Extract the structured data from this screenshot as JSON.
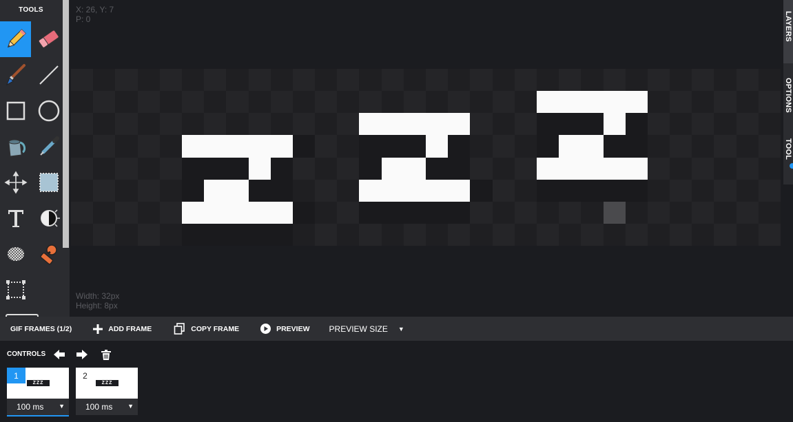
{
  "tools": {
    "title": "TOOLS",
    "items": [
      {
        "name": "pencil",
        "icon": "pencil-icon",
        "active": true
      },
      {
        "name": "eraser",
        "icon": "eraser-icon"
      },
      {
        "name": "brush",
        "icon": "brush-icon"
      },
      {
        "name": "line",
        "icon": "line-icon"
      },
      {
        "name": "rectangle",
        "icon": "rectangle-icon"
      },
      {
        "name": "ellipse",
        "icon": "ellipse-icon"
      },
      {
        "name": "fill",
        "icon": "paint-bucket-icon"
      },
      {
        "name": "eyedropper",
        "icon": "eyedropper-icon"
      },
      {
        "name": "move",
        "icon": "move-icon"
      },
      {
        "name": "select",
        "icon": "select-icon"
      },
      {
        "name": "text",
        "icon": "text-icon"
      },
      {
        "name": "dodge-burn",
        "icon": "dodge-burn-icon"
      },
      {
        "name": "dither",
        "icon": "dither-icon"
      },
      {
        "name": "stamp",
        "icon": "stamp-icon"
      },
      {
        "name": "crop",
        "icon": "crop-icon"
      }
    ]
  },
  "canvas": {
    "coords_line": "X: 26, Y: 7",
    "pixel_line": "P: 0",
    "width_line": "Width: 32px",
    "height_line": "Height: 8px",
    "cols": 32,
    "rows": 8,
    "white_pixels": [
      [
        2,
        22
      ],
      [
        2,
        23
      ],
      [
        2,
        24
      ],
      [
        2,
        25
      ],
      [
        2,
        26
      ],
      [
        3,
        14
      ],
      [
        3,
        15
      ],
      [
        3,
        16
      ],
      [
        3,
        17
      ],
      [
        3,
        18
      ],
      [
        3,
        25
      ],
      [
        4,
        6
      ],
      [
        4,
        7
      ],
      [
        4,
        8
      ],
      [
        4,
        9
      ],
      [
        4,
        10
      ],
      [
        4,
        17
      ],
      [
        4,
        23
      ],
      [
        4,
        24
      ],
      [
        5,
        9
      ],
      [
        5,
        15
      ],
      [
        5,
        16
      ],
      [
        5,
        22
      ],
      [
        5,
        23
      ],
      [
        5,
        24
      ],
      [
        5,
        25
      ],
      [
        5,
        26
      ],
      [
        6,
        7
      ],
      [
        6,
        8
      ],
      [
        6,
        14
      ],
      [
        6,
        15
      ],
      [
        6,
        16
      ],
      [
        6,
        17
      ],
      [
        6,
        18
      ],
      [
        7,
        6
      ],
      [
        7,
        7
      ],
      [
        7,
        8
      ],
      [
        7,
        9
      ],
      [
        7,
        10
      ]
    ],
    "black_pixels": [
      [
        3,
        22
      ],
      [
        3,
        23
      ],
      [
        3,
        24
      ],
      [
        3,
        26
      ],
      [
        4,
        11
      ],
      [
        4,
        14
      ],
      [
        4,
        15
      ],
      [
        4,
        16
      ],
      [
        4,
        18
      ],
      [
        4,
        22
      ],
      [
        4,
        25
      ],
      [
        4,
        26
      ],
      [
        5,
        6
      ],
      [
        5,
        7
      ],
      [
        5,
        8
      ],
      [
        5,
        10
      ],
      [
        5,
        14
      ],
      [
        5,
        17
      ],
      [
        5,
        18
      ],
      [
        6,
        6
      ],
      [
        6,
        9
      ],
      [
        6,
        10
      ],
      [
        6,
        19
      ],
      [
        6,
        22
      ],
      [
        6,
        23
      ],
      [
        6,
        24
      ],
      [
        6,
        25
      ],
      [
        6,
        26
      ],
      [
        7,
        11
      ],
      [
        7,
        14
      ],
      [
        7,
        15
      ],
      [
        7,
        16
      ],
      [
        7,
        17
      ],
      [
        7,
        18
      ],
      [
        8,
        6
      ],
      [
        8,
        7
      ],
      [
        8,
        8
      ],
      [
        8,
        9
      ],
      [
        8,
        10
      ]
    ],
    "gray_pixels": [
      [
        7,
        25
      ]
    ],
    "checker_light": "#252528",
    "checker_dark": "#1f1f22",
    "white": "#fafafa",
    "black": "#1a1a1d",
    "gray": "#4a4a4d"
  },
  "right_tabs": {
    "layers": "LAYERS",
    "options": "OPTIONS",
    "tool": "TOOL"
  },
  "framebar": {
    "gif_frames": "GIF FRAMES (1/2)",
    "add_frame": "ADD FRAME",
    "copy_frame": "COPY FRAME",
    "preview": "PREVIEW",
    "preview_size": "PREVIEW SIZE",
    "caret": "▼"
  },
  "controls": {
    "label": "CONTROLS",
    "frames": [
      {
        "number": "1",
        "duration": "100 ms",
        "selected": true,
        "mini": "ZZZ"
      },
      {
        "number": "2",
        "duration": "100 ms",
        "selected": false,
        "mini": "ZZZ"
      }
    ],
    "caret": "▼"
  },
  "colors": {
    "accent": "#2196f3",
    "panel": "#2b2c30",
    "background": "#1b1c20"
  }
}
